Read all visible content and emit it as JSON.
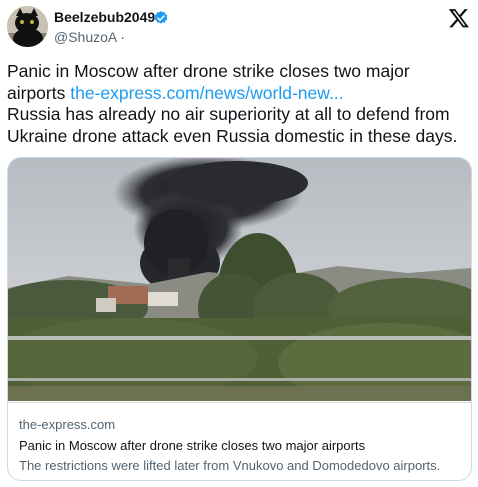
{
  "author": {
    "display_name": "Beelzebub2049",
    "handle": "@ShuzoA",
    "separator": "·",
    "verified": true,
    "avatar_icon": "black-cat-avatar"
  },
  "platform_logo": "x-logo-icon",
  "tweet": {
    "line1": "Panic in Moscow after drone strike closes two major",
    "line2_prefix": "airports",
    "link_text": "the-express.com/news/world-new...",
    "line3": "Russia has already no air superiority at all to defend from",
    "line4": "Ukraine drone attack even Russia domestic in these days."
  },
  "card": {
    "domain": "the-express.com",
    "title": "Panic in Moscow after drone strike closes two major airports",
    "description": "The restrictions were lifted later from Vnukovo and Domodedovo airports.",
    "image_subject": "black-smoke-plume-over-trees-photo"
  },
  "colors": {
    "link": "#1d9bf0",
    "verified_badge": "#1d9bf0",
    "secondary_text": "#536471",
    "border": "#cfd9de"
  }
}
